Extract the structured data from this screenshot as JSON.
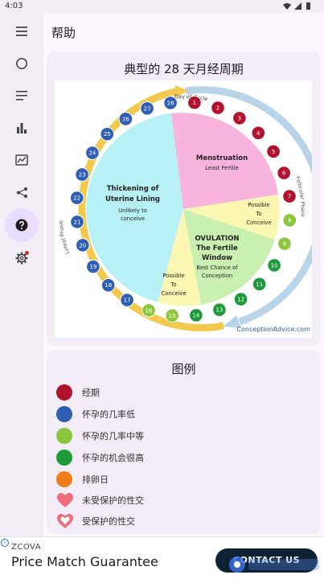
{
  "status_bar": {
    "time": "4:03"
  },
  "header": {
    "title": "帮助"
  },
  "nav": {
    "items": [
      {
        "name": "menu",
        "icon": "menu-icon"
      },
      {
        "name": "cycle",
        "icon": "circle-icon"
      },
      {
        "name": "notes",
        "icon": "notes-icon"
      },
      {
        "name": "stats",
        "icon": "bar-chart-icon"
      },
      {
        "name": "report",
        "icon": "chart-screen-icon"
      },
      {
        "name": "share",
        "icon": "share-icon"
      },
      {
        "name": "help",
        "icon": "help-icon",
        "active": true
      },
      {
        "name": "settings",
        "icon": "gear-icon",
        "badge": true
      }
    ]
  },
  "chart_card": {
    "title": "典型的 28 天月经周期",
    "image": {
      "day_of_cycle_label": "Day of Cycle",
      "follicular_label": "Follicular Phase",
      "luteal_label": "Luteal Phase",
      "menstruation_title": "Menstruation",
      "menstruation_sub": "Least Fertile",
      "thickening_title_1": "Thickening of",
      "thickening_title_2": "Uterine Lining",
      "thickening_sub_1": "Unlikely to",
      "thickening_sub_2": "conceive",
      "possible_right_1": "Possible",
      "possible_right_2": "To",
      "possible_right_3": "Conceive",
      "ovulation_1": "OVULATION",
      "ovulation_2": "The Fertile",
      "ovulation_3": "Window",
      "ovulation_sub_1": "Best Chance of",
      "ovulation_sub_2": "Conception",
      "possible_bottom_1": "Possible",
      "possible_bottom_2": "To",
      "possible_bottom_3": "Conceive",
      "credit": "ConceptionAdvice.com"
    }
  },
  "legend": {
    "title": "图例",
    "items": [
      {
        "label": "经期",
        "color": "#b3122e",
        "shape": "dot"
      },
      {
        "label": "怀孕的几率低",
        "color": "#2f5fb3",
        "shape": "dot"
      },
      {
        "label": "怀孕的几率中等",
        "color": "#8cc63f",
        "shape": "dot"
      },
      {
        "label": "怀孕的机会很高",
        "color": "#1f9a3a",
        "shape": "dot"
      },
      {
        "label": "排卵日",
        "color": "#ef7d1a",
        "shape": "dot"
      },
      {
        "label": "未受保护的性交",
        "color": "#f06b7e",
        "shape": "heart"
      },
      {
        "label": "受保护的性交",
        "color": "#f06b7e",
        "shape": "heart-outline"
      }
    ]
  },
  "ad": {
    "brand": "ZCOVA",
    "headline": "Price Match Guarantee",
    "cta": "CONTACT US"
  }
}
